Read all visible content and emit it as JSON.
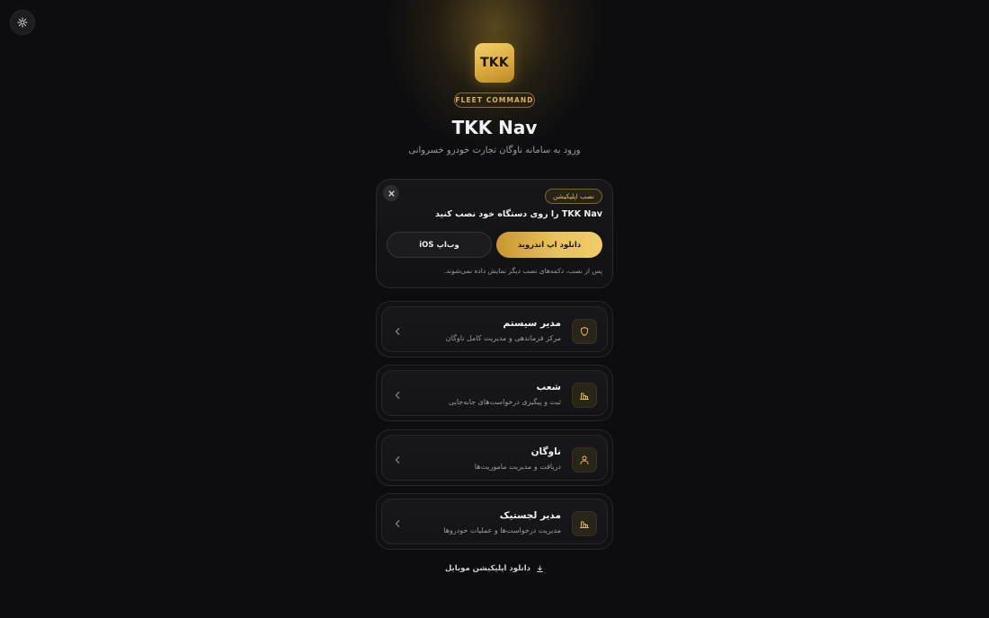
{
  "brand": {
    "logo_text": "TKK",
    "badge": "FLEET COMMAND",
    "title": "TKK Nav",
    "subtitle": "ورود به سامانه ناوگان تجارت خودرو خسروانی",
    "accent_color": "#e8c15a"
  },
  "theme_toggle": {
    "icon": "sun-icon"
  },
  "install": {
    "tag": "نصب اپلیکیشن",
    "heading": "TKK Nav را روی دستگاه خود نصب کنید",
    "android_label": "دانلود اپ اندروید",
    "ios_label": "وب‌اپ iOS",
    "note": "پس از نصب، دکمه‌های نصب دیگر نمایش داده نمی‌شوند.",
    "close_icon": "close-icon"
  },
  "roles": [
    {
      "title": "مدیر سیستم",
      "desc": "مرکز فرماندهی و مدیریت کامل ناوگان",
      "icon": "shield-icon"
    },
    {
      "title": "شعب",
      "desc": "ثبت و پیگیری درخواست‌های جابه‌جایی",
      "icon": "building-icon"
    },
    {
      "title": "ناوگان",
      "desc": "دریافت و مدیریت ماموریت‌ها",
      "icon": "user-icon"
    },
    {
      "title": "مدیر لجستیک",
      "desc": "مدیریت درخواست‌ها و عملیات خودروها",
      "icon": "building-icon"
    }
  ],
  "footer": {
    "download_label": "دانلود اپلیکیشن موبایل",
    "download_icon": "download-icon"
  }
}
